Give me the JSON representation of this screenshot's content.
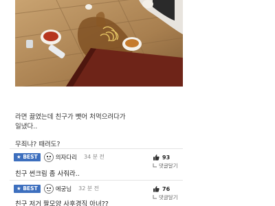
{
  "post": {
    "lines": [
      "라면 끓였는데 친구가 뺏어 처먹으려다가",
      "일냈다..",
      "",
      "무죄냐? 때려도?"
    ]
  },
  "comments": [
    {
      "badge": "★ BEST",
      "nickname": "의자다리",
      "time": "34 분 전",
      "likes": "93",
      "reply_label": "댓글달기",
      "text": "친구 썬크림 좀 사줘라.."
    },
    {
      "badge": "★ BEST",
      "nickname": "에궁님",
      "time": "32 분 전",
      "likes": "76",
      "reply_label": "댓글달기",
      "text": "친구 저거 팔모양 사후경직 아녀??"
    }
  ],
  "colors": {
    "best_badge": "#3d6fbe",
    "floor": "#b08a5a",
    "table": "#6e2418"
  },
  "icons": {
    "like": "thumbs-up-icon",
    "reply": "reply-arrow-icon",
    "avatar": "cartoon-face-avatar"
  }
}
